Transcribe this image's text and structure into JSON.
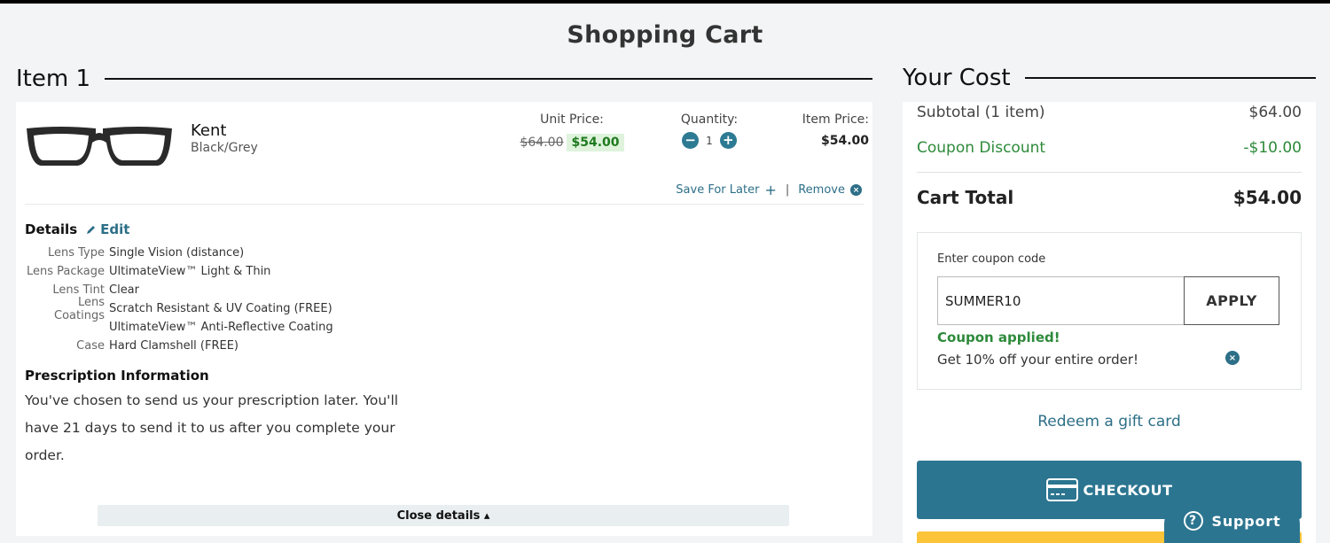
{
  "page": {
    "title": "Shopping Cart"
  },
  "item_section": {
    "heading": "Item 1"
  },
  "item": {
    "name": "Kent",
    "color": "Black/Grey",
    "unit_price_label": "Unit Price:",
    "unit_price_old": "$64.00",
    "unit_price_new": "$54.00",
    "quantity_label": "Quantity:",
    "quantity": "1",
    "item_price_label": "Item Price:",
    "item_price": "$54.00",
    "save_for_later": "Save For Later",
    "save_icon": "+",
    "separator": "|",
    "remove": "Remove",
    "remove_icon": "×",
    "minus_icon": "−",
    "plus_icon": "+"
  },
  "details": {
    "heading": "Details",
    "edit_label": "Edit",
    "rows": [
      {
        "key": "Lens Type",
        "value": "Single Vision (distance)"
      },
      {
        "key": "Lens Package",
        "value": "UltimateView™ Light & Thin"
      },
      {
        "key": "Lens Tint",
        "value": "Clear"
      },
      {
        "key": "Lens Coatings",
        "value": "Scratch Resistant & UV Coating (FREE)"
      },
      {
        "key": "",
        "value": "UltimateView™ Anti-Reflective Coating"
      },
      {
        "key": "Case",
        "value": "Hard Clamshell (FREE)"
      }
    ],
    "rx_heading": "Prescription Information",
    "rx_text": "You've chosen to send us your prescription later. You'll have 21 days to send it to us after you complete your order.",
    "close_label": "Close details ▴"
  },
  "cost_section": {
    "heading": "Your Cost",
    "subtotal_label": "Subtotal (1 item)",
    "subtotal_value": "$64.00",
    "discount_label": "Coupon Discount",
    "discount_value": "-$10.00",
    "total_label": "Cart Total",
    "total_value": "$54.00"
  },
  "coupon": {
    "label": "Enter coupon code",
    "value": "SUMMER10",
    "apply_label": "APPLY",
    "status": "Coupon applied!",
    "description": "Get 10% off your entire order!",
    "remove_icon": "×"
  },
  "gift_card": {
    "label": "Redeem a gift card"
  },
  "checkout": {
    "label": "CHECKOUT"
  },
  "support": {
    "label": "Support",
    "icon": "?"
  },
  "colors": {
    "accent": "#2c7590",
    "discount_green": "#2d8a3a",
    "paypal_yellow": "#fcc438"
  }
}
